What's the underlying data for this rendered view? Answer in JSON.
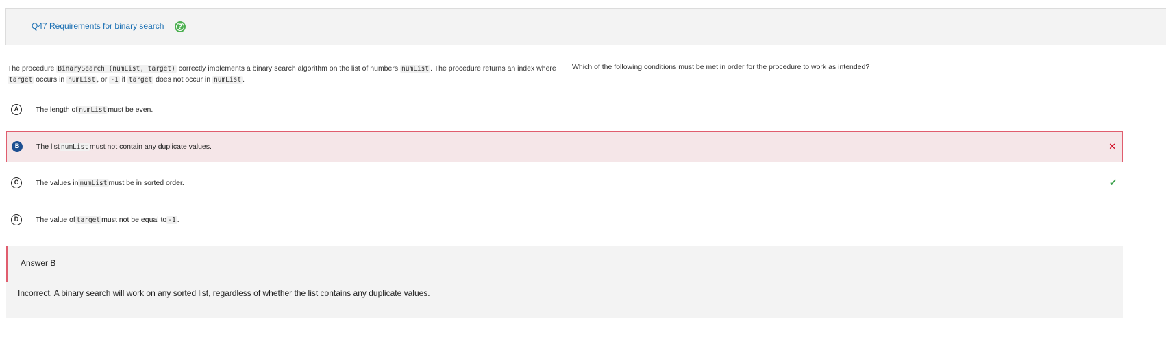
{
  "header": {
    "title": "Q47 Requirements for binary search",
    "help_icon": "help-icon"
  },
  "stem": {
    "t1": "The procedure ",
    "c1": "BinarySearch (numList, target)",
    "t2": " correctly implements a binary search algorithm on the list of numbers ",
    "c2": "numList",
    "t3": ". The procedure returns an index where ",
    "c3": "target",
    "t4": " occurs in ",
    "c4": "numList",
    "t5": ", or ",
    "c5": "-1",
    "t6": " if ",
    "c6": "target",
    "t7": " does not occur in ",
    "c7": "numList",
    "t8": "."
  },
  "question": "Which of the following conditions must be met in order for the procedure to work as intended?",
  "options": [
    {
      "letter": "A",
      "pre": "The length of",
      "code": "numList",
      "post": "must be even."
    },
    {
      "letter": "B",
      "pre": "The list",
      "code": "numList",
      "post": "must not contain any duplicate values.",
      "mark": "✕"
    },
    {
      "letter": "C",
      "pre": "The values in",
      "code": "numList",
      "post": "must be in sorted order.",
      "mark": "✔"
    },
    {
      "letter": "D",
      "pre": "The value of",
      "code": "target",
      "post": "must not be equal to",
      "code2": "-1",
      "post2": "."
    }
  ],
  "answer": {
    "label": "Answer B",
    "explanation": "Incorrect. A binary search will work on any sorted list, regardless of whether the list contains any duplicate values."
  },
  "colors": {
    "title": "#1a6fb3",
    "selected_bg": "#f5e6e8",
    "selected_border": "#e05d6e",
    "wrong": "#d0021b",
    "correct": "#3aa04a"
  }
}
